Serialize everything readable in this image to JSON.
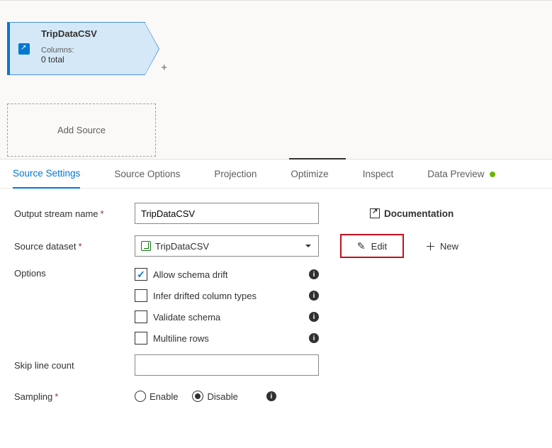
{
  "node": {
    "title": "TripDataCSV",
    "columns_label": "Columns:",
    "columns_value": "0 total"
  },
  "add_source_label": "Add Source",
  "tabs": {
    "source_settings": "Source Settings",
    "source_options": "Source Options",
    "projection": "Projection",
    "optimize": "Optimize",
    "inspect": "Inspect",
    "data_preview": "Data Preview"
  },
  "form": {
    "output_stream_label": "Output stream name",
    "output_stream_value": "TripDataCSV",
    "source_dataset_label": "Source dataset",
    "source_dataset_value": "TripDataCSV",
    "documentation_label": "Documentation",
    "edit_label": "Edit",
    "new_label": "New",
    "options_label": "Options",
    "opt_allow_drift": "Allow schema drift",
    "opt_infer": "Infer drifted column types",
    "opt_validate": "Validate schema",
    "opt_multiline": "Multiline rows",
    "skip_lines_label": "Skip line count",
    "sampling_label": "Sampling",
    "sampling_enable": "Enable",
    "sampling_disable": "Disable"
  }
}
